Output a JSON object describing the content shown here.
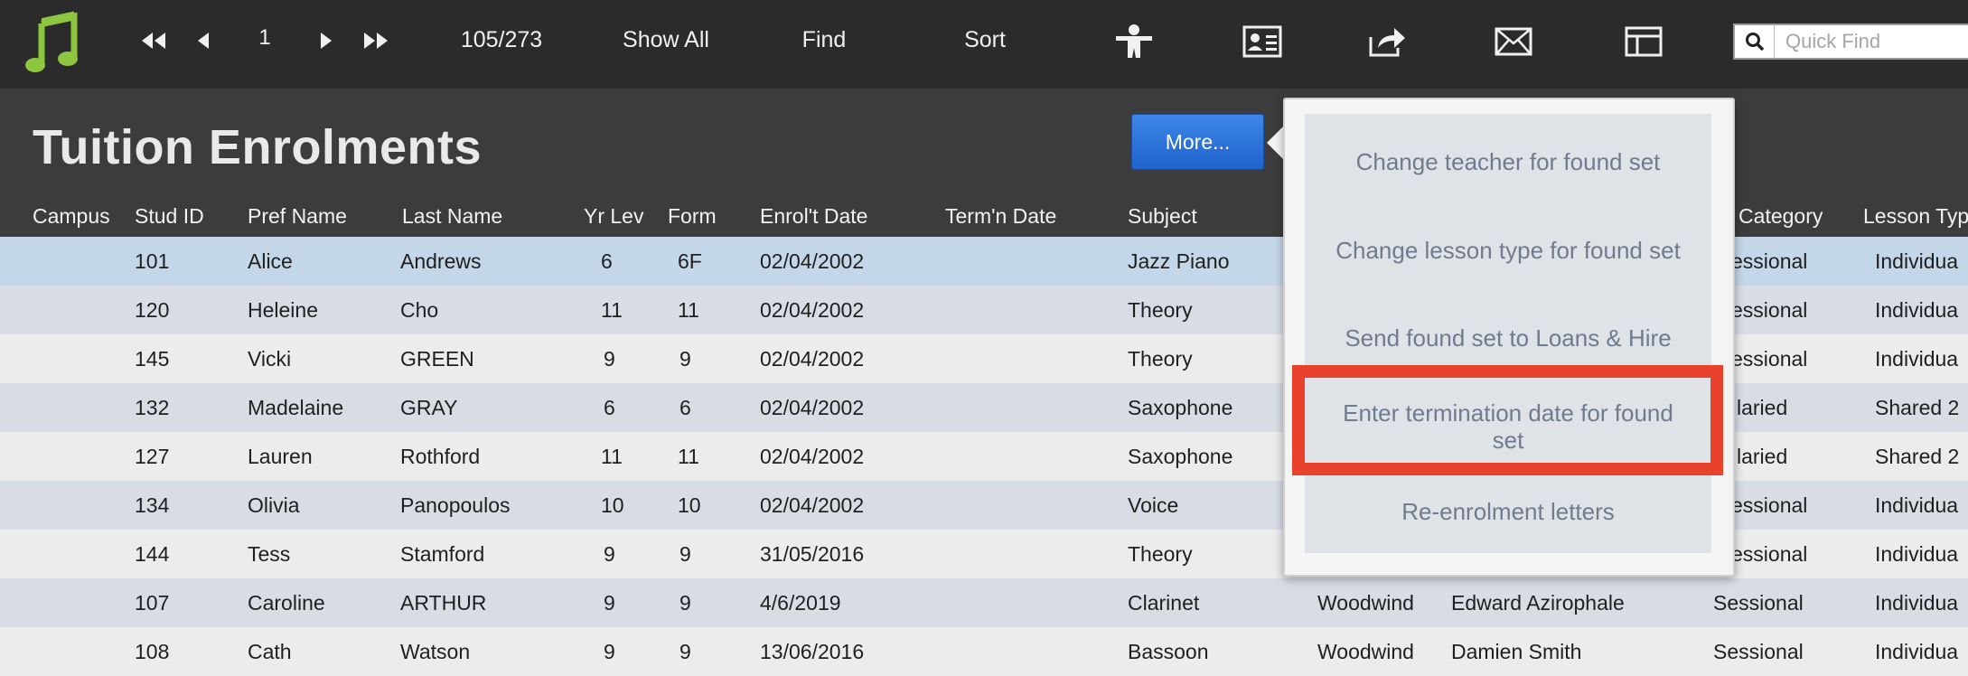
{
  "colors": {
    "toolbar_bg": "#2b2b2b",
    "header_bg": "#3c3c3c",
    "logo_green": "#8dc63f",
    "more_button": "#2a6fd6",
    "highlight": "#e8412c",
    "row_alt": "#d8dde5",
    "row_selected": "#c4d7e8"
  },
  "toolbar": {
    "logo_icon": "music-note-icon",
    "record_number": "1",
    "record_count": "105/273",
    "show_all_label": "Show All",
    "find_label": "Find",
    "sort_label": "Sort",
    "icons": [
      "first-record-icon",
      "previous-record-icon",
      "next-record-icon",
      "last-record-icon",
      "person-icon",
      "contact-card-icon",
      "share-export-icon",
      "mail-icon",
      "layout-icon",
      "search-icon"
    ],
    "quick_find_placeholder": "Quick Find"
  },
  "header": {
    "title": "Tuition Enrolments",
    "more_button_label": "More..."
  },
  "columns": [
    "Campus",
    "Stud ID",
    "Pref Name",
    "Last Name",
    "Yr Lev",
    "Form",
    "Enrol't Date",
    "Term'n Date",
    "Subject",
    "r Category",
    "Lesson Typ"
  ],
  "rows": [
    {
      "campus": "",
      "stud_id": "101",
      "pref_name": "Alice",
      "last_name": "Andrews",
      "yr_lev": "6",
      "form": "6F",
      "enrol_date": "02/04/2002",
      "term_date": "",
      "subject": "Jazz Piano",
      "dept": "",
      "teacher": "",
      "category": "Sessional",
      "lesson_type": "Individua",
      "category_visible": "essional"
    },
    {
      "campus": "",
      "stud_id": "120",
      "pref_name": "Heleine",
      "last_name": "Cho",
      "yr_lev": "11",
      "form": "11",
      "enrol_date": "02/04/2002",
      "term_date": "",
      "subject": "Theory",
      "dept": "",
      "teacher": "",
      "category_visible": "essional",
      "lesson_type": "Individua"
    },
    {
      "campus": "",
      "stud_id": "145",
      "pref_name": "Vicki",
      "last_name": "GREEN",
      "yr_lev": "9",
      "form": "9",
      "enrol_date": "02/04/2002",
      "term_date": "",
      "subject": "Theory",
      "dept": "",
      "teacher": "",
      "category_visible": "essional",
      "lesson_type": "Individua"
    },
    {
      "campus": "",
      "stud_id": "132",
      "pref_name": "Madelaine",
      "last_name": "GRAY",
      "yr_lev": "6",
      "form": "6",
      "enrol_date": "02/04/2002",
      "term_date": "",
      "subject": "Saxophone",
      "dept": "",
      "teacher": "",
      "category_visible": "laried",
      "lesson_type": "Shared 2"
    },
    {
      "campus": "",
      "stud_id": "127",
      "pref_name": "Lauren",
      "last_name": "Rothford",
      "yr_lev": "11",
      "form": "11",
      "enrol_date": "02/04/2002",
      "term_date": "",
      "subject": "Saxophone",
      "dept": "",
      "teacher": "",
      "category_visible": "laried",
      "lesson_type": "Shared 2"
    },
    {
      "campus": "",
      "stud_id": "134",
      "pref_name": "Olivia",
      "last_name": "Panopoulos",
      "yr_lev": "10",
      "form": "10",
      "enrol_date": "02/04/2002",
      "term_date": "",
      "subject": "Voice",
      "dept": "",
      "teacher": "",
      "category_visible": "essional",
      "lesson_type": "Individua"
    },
    {
      "campus": "",
      "stud_id": "144",
      "pref_name": "Tess",
      "last_name": "Stamford",
      "yr_lev": "9",
      "form": "9",
      "enrol_date": "31/05/2016",
      "term_date": "",
      "subject": "Theory",
      "dept": "",
      "teacher": "",
      "category_visible": "essional",
      "lesson_type": "Individua"
    },
    {
      "campus": "",
      "stud_id": "107",
      "pref_name": "Caroline",
      "last_name": "ARTHUR",
      "yr_lev": "9",
      "form": "9",
      "enrol_date": "4/6/2019",
      "term_date": "",
      "subject": "Clarinet",
      "dept": "Woodwind",
      "teacher": "Edward Azirophale",
      "category_visible": "Sessional",
      "lesson_type": "Individua"
    },
    {
      "campus": "",
      "stud_id": "108",
      "pref_name": "Cath",
      "last_name": "Watson",
      "yr_lev": "9",
      "form": "9",
      "enrol_date": "13/06/2016",
      "term_date": "",
      "subject": "Bassoon",
      "dept": "Woodwind",
      "teacher": "Damien Smith",
      "category_visible": "Sessional",
      "lesson_type": "Individua"
    }
  ],
  "popover": {
    "items": [
      "Change teacher for found set",
      "Change lesson type for found set",
      "Send found set to Loans & Hire",
      "Enter termination date for found set",
      "Re-enrolment letters"
    ],
    "highlighted_index": 3
  }
}
